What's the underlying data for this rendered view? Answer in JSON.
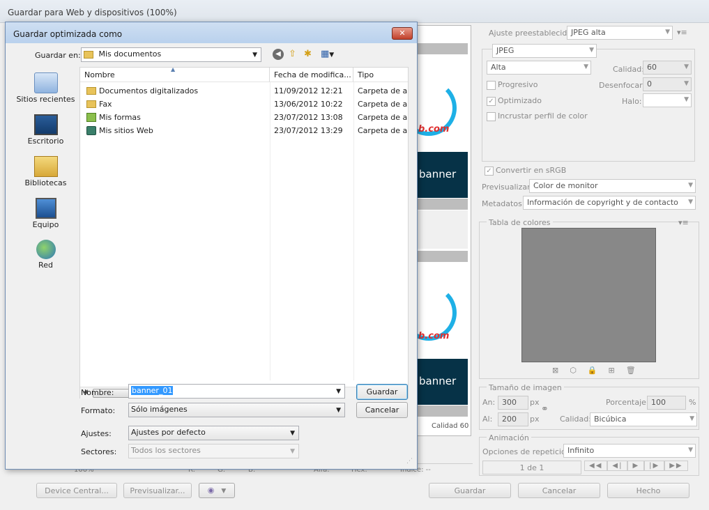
{
  "window": {
    "title": "Guardar para Web y dispositivos (100%)"
  },
  "right_panel": {
    "preset_label": "Ajuste preestablecido:",
    "preset_value": "JPEG alta",
    "format_value": "JPEG",
    "quality_combo": "Alta",
    "quality_label": "Calidad:",
    "quality_value": "60",
    "progressive": "Progresivo",
    "blur_label": "Desenfocar:",
    "blur_value": "0",
    "optimized": "Optimizado",
    "matte_label": "Halo:",
    "embed_profile": "Incrustar perfil de color",
    "convert_srgb": "Convertir en sRGB",
    "preview_label": "Previsualizar:",
    "preview_value": "Color de monitor",
    "metadata_label": "Metadatos:",
    "metadata_value": "Información de copyright y de contacto",
    "color_table_title": "Tabla de colores",
    "image_size_title": "Tamaño de imagen",
    "width_label": "An:",
    "width_value": "300",
    "height_label": "Al:",
    "height_value": "200",
    "px": "px",
    "percent_label": "Porcentaje:",
    "percent_value": "100",
    "percent_unit": "%",
    "resample_label": "Calidad:",
    "resample_value": "Bicúbica",
    "animation_title": "Animación",
    "loop_label": "Opciones de repetición:",
    "loop_value": "Infinito",
    "frame_counter": "1 de 1"
  },
  "preview": {
    "domain_fragment": "b.com",
    "banner_text": "banner",
    "quality_note": "Calidad 60",
    "zoom_value": "100%",
    "readout": {
      "r": "R:",
      "g": "G:",
      "b": "B:",
      "alpha": "Alfa:",
      "hex": "Hex:",
      "index": "Índice: --"
    }
  },
  "bottom_buttons": {
    "device_central": "Device Central...",
    "preview": "Previsualizar...",
    "save": "Guardar",
    "cancel": "Cancelar",
    "done": "Hecho"
  },
  "dialog": {
    "title": "Guardar optimizada como",
    "close_glyph": "✕",
    "save_in_label": "Guardar en:",
    "save_in_value": "Mis documentos",
    "places": [
      "Sitios recientes",
      "Escritorio",
      "Bibliotecas",
      "Equipo",
      "Red"
    ],
    "columns": {
      "name": "Nombre",
      "date": "Fecha de modifica...",
      "type": "Tipo"
    },
    "files": [
      {
        "name": "Documentos digitalizados",
        "date": "11/09/2012 12:21",
        "type": "Carpeta de arc"
      },
      {
        "name": "Fax",
        "date": "13/06/2012 10:22",
        "type": "Carpeta de arc"
      },
      {
        "name": "Mis formas",
        "date": "23/07/2012 13:08",
        "type": "Carpeta de arc"
      },
      {
        "name": "Mis sitios Web",
        "date": "23/07/2012 13:29",
        "type": "Carpeta de arc"
      }
    ],
    "filename_label": "Nombre:",
    "filename_value": "banner_01",
    "format_label": "Formato:",
    "format_value": "Sólo imágenes",
    "settings_label": "Ajustes:",
    "settings_value": "Ajustes por defecto",
    "slices_label": "Sectores:",
    "slices_value": "Todos los sectores",
    "save_button": "Guardar",
    "cancel_button": "Cancelar"
  }
}
